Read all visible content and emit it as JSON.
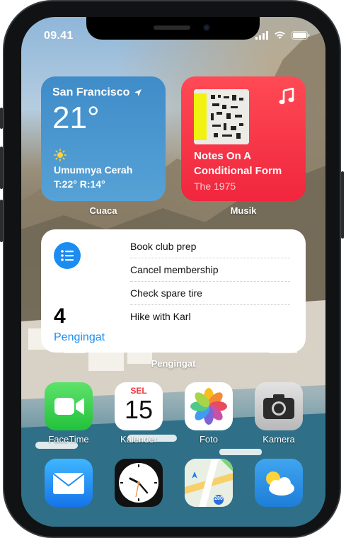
{
  "status_bar": {
    "time": "09.41"
  },
  "widgets": {
    "weather": {
      "city": "San Francisco",
      "temperature": "21°",
      "condition": "Umumnya Cerah",
      "range": "T:22° R:14°",
      "label": "Cuaca",
      "icon": "sun-icon"
    },
    "music": {
      "album_title": "Notes On A Conditional Form",
      "artist": "The 1975",
      "label": "Musik",
      "icon": "music-note-icon"
    },
    "reminders": {
      "count": "4",
      "title": "Pengingat",
      "label": "Pengingat",
      "items": [
        "Book club prep",
        "Cancel membership",
        "Check spare tire",
        "Hike with Karl"
      ]
    }
  },
  "apps": {
    "facetime": {
      "label": "FaceTime"
    },
    "calendar": {
      "label": "Kalender",
      "day_abbr": "SEL",
      "date": "15"
    },
    "photos": {
      "label": "Foto"
    },
    "camera": {
      "label": "Kamera"
    },
    "mail": {
      "label": ""
    },
    "clock": {
      "label": ""
    },
    "maps": {
      "label": "",
      "route_number": "280"
    },
    "weather": {
      "label": ""
    }
  },
  "colors": {
    "weather_widget": "#4a96d0",
    "music_widget": "#f5354a",
    "reminders_accent": "#1a8cf2"
  }
}
